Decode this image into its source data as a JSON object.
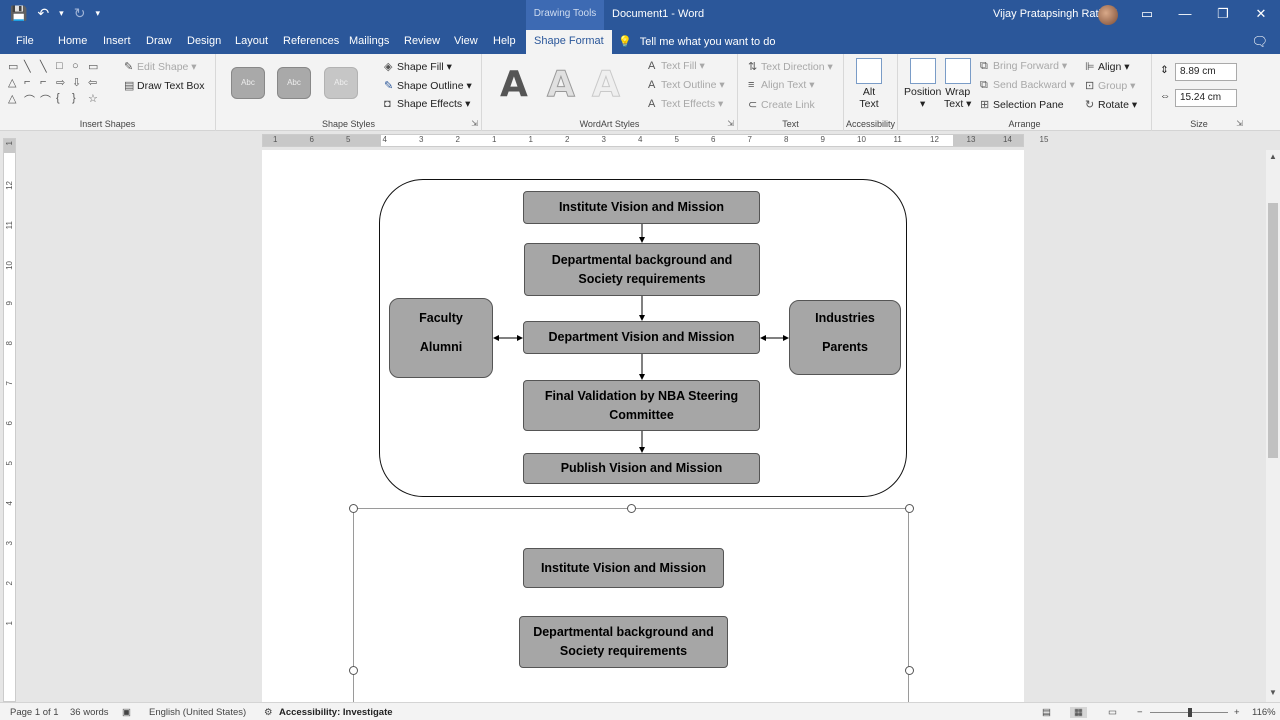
{
  "titlebar": {
    "contextual_tab": "Drawing Tools",
    "doc_title": "Document1 - Word",
    "user_name": "Vijay Pratapsingh Rathod",
    "qat": {
      "save_icon": "💾",
      "undo_icon": "↶",
      "undo_drop": "▾",
      "redo_icon": "↻",
      "customize": "▾"
    },
    "window_controls": {
      "ribbon_display": "▭",
      "minimize": "—",
      "restore": "❐",
      "close": "✕"
    }
  },
  "tabs": [
    "File",
    "Home",
    "Insert",
    "Draw",
    "Design",
    "Layout",
    "References",
    "Mailings",
    "Review",
    "View",
    "Help"
  ],
  "active_tab": "Shape Format",
  "tell_me": "Tell me what you want to do",
  "tell_me_icon": "💡",
  "comments_icon": "🗨",
  "ribbon": {
    "insert_shapes": {
      "label": "Insert Shapes",
      "edit_shape": "Edit Shape",
      "draw_text_box": "Draw Text Box",
      "shape_glyphs": [
        "▭",
        "╲",
        "╲",
        "□",
        "○",
        "▭",
        "△",
        "⌐",
        "⌐",
        "⇨",
        "⇩",
        "⇦",
        "△",
        "⌒",
        "⌒",
        "{",
        "}",
        "☆"
      ]
    },
    "shape_styles": {
      "label": "Shape Styles",
      "swatch_text": "Abc",
      "shape_fill": "Shape Fill",
      "shape_outline": "Shape Outline",
      "shape_effects": "Shape Effects"
    },
    "wordart_styles": {
      "label": "WordArt Styles",
      "letter": "A",
      "text_fill": "Text Fill",
      "text_outline": "Text Outline",
      "text_effects": "Text Effects"
    },
    "text": {
      "label": "Text",
      "text_direction": "Text Direction",
      "align_text": "Align Text",
      "create_link": "Create Link"
    },
    "accessibility": {
      "label": "Accessibility",
      "alt_text_1": "Alt",
      "alt_text_2": "Text"
    },
    "arrange": {
      "label": "Arrange",
      "position": "Position",
      "wrap_text_1": "Wrap",
      "wrap_text_2": "Text",
      "bring_forward": "Bring Forward",
      "send_backward": "Send Backward",
      "selection_pane": "Selection Pane",
      "align": "Align",
      "group": "Group",
      "rotate": "Rotate"
    },
    "size": {
      "label": "Size",
      "height": "8.89 cm",
      "width": "15.24 cm"
    }
  },
  "ruler": {
    "h_numbers": [
      "1",
      "6",
      "5",
      "4",
      "3",
      "2",
      "1",
      "1",
      "2",
      "3",
      "4",
      "5",
      "6",
      "7",
      "8",
      "9",
      "10",
      "11",
      "12",
      "13",
      "14",
      "15"
    ],
    "v_numbers": [
      "1",
      "12",
      "11",
      "10",
      "9",
      "8",
      "7",
      "6",
      "5",
      "4",
      "3",
      "2",
      "1"
    ]
  },
  "diagram": {
    "top": "Institute Vision and Mission",
    "dept_bg_1": "Departmental background and",
    "dept_bg_2": "Society requirements",
    "dept_vm": "Department Vision and Mission",
    "validation_1": "Final Validation  by NBA Steering",
    "validation_2": "Committee",
    "publish": "Publish Vision and Mission",
    "left_1": "Faculty",
    "left_2": "Alumni",
    "right_1": "Industries",
    "right_2": "Parents"
  },
  "diagram2": {
    "top": "Institute Vision and Mission",
    "dept_bg_1": "Departmental background and",
    "dept_bg_2": "Society requirements"
  },
  "statusbar": {
    "page": "Page 1 of 1",
    "words": "36 words",
    "language": "English (United States)",
    "accessibility": "Accessibility: Investigate",
    "zoom": "116%",
    "zoom_minus": "−",
    "zoom_plus": "+"
  }
}
